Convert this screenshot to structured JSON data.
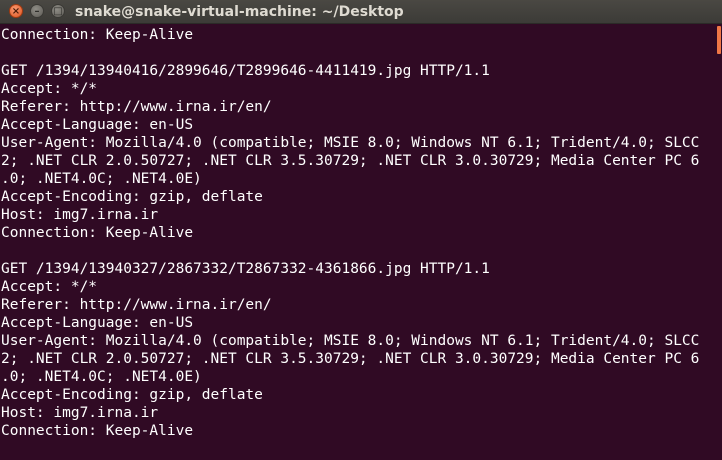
{
  "window": {
    "title": "snake@snake-virtual-machine: ~/Desktop",
    "close_glyph": "×",
    "minimize_glyph": "–",
    "maximize_glyph": "□"
  },
  "terminal": {
    "lines": [
      "Connection: Keep-Alive",
      "",
      "GET /1394/13940416/2899646/T2899646-4411419.jpg HTTP/1.1",
      "Accept: */*",
      "Referer: http://www.irna.ir/en/",
      "Accept-Language: en-US",
      "User-Agent: Mozilla/4.0 (compatible; MSIE 8.0; Windows NT 6.1; Trident/4.0; SLCC",
      "2; .NET CLR 2.0.50727; .NET CLR 3.5.30729; .NET CLR 3.0.30729; Media Center PC 6",
      ".0; .NET4.0C; .NET4.0E)",
      "Accept-Encoding: gzip, deflate",
      "Host: img7.irna.ir",
      "Connection: Keep-Alive",
      "",
      "GET /1394/13940327/2867332/T2867332-4361866.jpg HTTP/1.1",
      "Accept: */*",
      "Referer: http://www.irna.ir/en/",
      "Accept-Language: en-US",
      "User-Agent: Mozilla/4.0 (compatible; MSIE 8.0; Windows NT 6.1; Trident/4.0; SLCC",
      "2; .NET CLR 2.0.50727; .NET CLR 3.5.30729; .NET CLR 3.0.30729; Media Center PC 6",
      ".0; .NET4.0C; .NET4.0E)",
      "Accept-Encoding: gzip, deflate",
      "Host: img7.irna.ir",
      "Connection: Keep-Alive",
      ""
    ]
  },
  "colors": {
    "background": "#300a24",
    "text": "#ffffff",
    "scroll_thumb": "#f07746",
    "close_button": "#e0541f"
  }
}
